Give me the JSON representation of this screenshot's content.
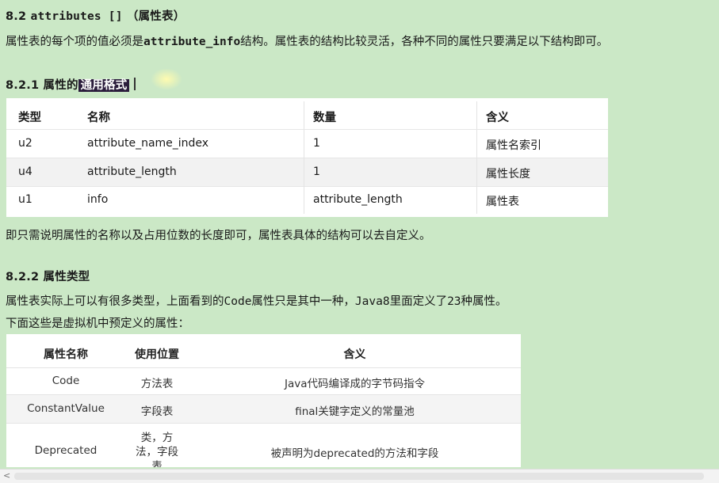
{
  "section_title": {
    "num": "8.2",
    "code": "attributes []",
    "label": "（属性表）"
  },
  "intro": {
    "before": "属性表的每个项的值必须是",
    "code": "attribute_info",
    "after": "结构。属性表的结构比较灵活，各种不同的属性只要满足以下结构即可。"
  },
  "sub1": {
    "num": "8.2.1",
    "plain": "属性的",
    "highlight": "通用格式"
  },
  "table1": {
    "headers": [
      "类型",
      "名称",
      "数量",
      "含义"
    ],
    "rows": [
      [
        "u2",
        "attribute_name_index",
        "1",
        "属性名索引"
      ],
      [
        "u4",
        "attribute_length",
        "1",
        "属性长度"
      ],
      [
        "u1",
        "info",
        "attribute_length",
        "属性表"
      ]
    ]
  },
  "note1": "即只需说明属性的名称以及占用位数的长度即可，属性表具体的结构可以去自定义。",
  "sub2": {
    "num": "8.2.2",
    "label": "属性类型"
  },
  "para2": {
    "before": "属性表实际上可以有很多类型，上面看到的",
    "code1": "Code",
    "mid": "属性只是其中一种，",
    "code2": "Java8",
    "mid2": "里面定义了",
    "num": "23",
    "after": "种属性。"
  },
  "para3": "下面这些是虚拟机中预定义的属性：",
  "table2": {
    "headers": [
      "属性名称",
      "使用位置",
      "含义"
    ],
    "rows": [
      {
        "name": "Code",
        "pos": [
          "方法表"
        ],
        "meaning": "Java代码编译成的字节码指令"
      },
      {
        "name": "ConstantValue",
        "pos": [
          "字段表"
        ],
        "meaning": "final关键字定义的常量池"
      },
      {
        "name": "Deprecated",
        "pos": [
          "类，方",
          "法，字段",
          "表"
        ],
        "meaning": "被声明为deprecated的方法和字段"
      }
    ]
  },
  "scrollbar": {
    "left_arrow": "<"
  }
}
